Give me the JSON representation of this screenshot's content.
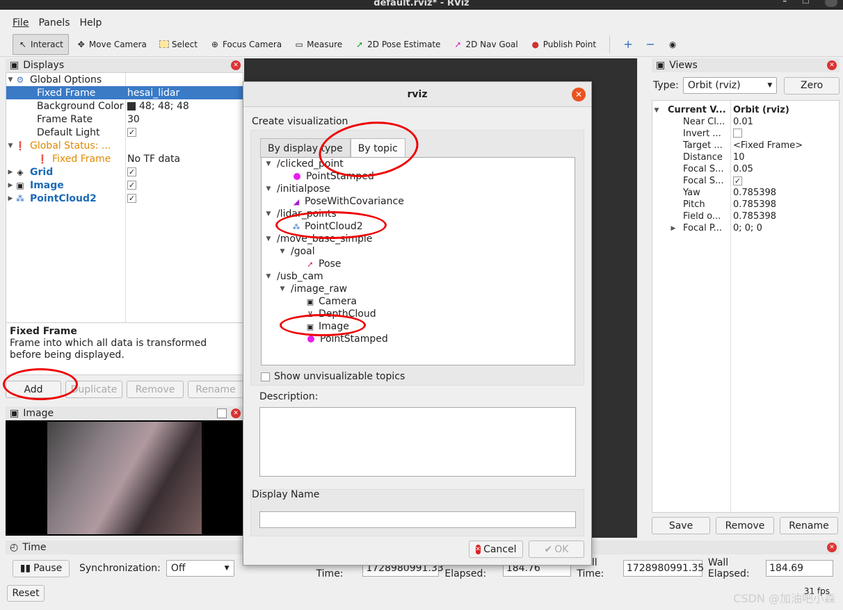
{
  "window": {
    "title": "default.rviz* - RViz",
    "min_label": "–",
    "max_label": "☐"
  },
  "menu": [
    "File",
    "Panels",
    "Help"
  ],
  "toolbar": {
    "tools": [
      {
        "label": "Interact",
        "icon": "cursor-icon"
      },
      {
        "label": "Move Camera",
        "icon": "move-icon"
      },
      {
        "label": "Select",
        "icon": "select-icon"
      },
      {
        "label": "Focus Camera",
        "icon": "focus-icon"
      },
      {
        "label": "Measure",
        "icon": "ruler-icon"
      },
      {
        "label": "2D Pose Estimate",
        "icon": "green-arrow-icon"
      },
      {
        "label": "2D Nav Goal",
        "icon": "pink-arrow-icon"
      },
      {
        "label": "Publish Point",
        "icon": "pin-icon"
      }
    ]
  },
  "displays": {
    "title": "Displays",
    "rows": [
      {
        "label": "Global Options",
        "value": ""
      },
      {
        "label": "Fixed Frame",
        "value": "hesai_lidar"
      },
      {
        "label": "Background Color",
        "value": "48; 48; 48"
      },
      {
        "label": "Frame Rate",
        "value": "30"
      },
      {
        "label": "Default Light",
        "value": "✓"
      },
      {
        "label": "Global Status: ...",
        "value": ""
      },
      {
        "label": "Fixed Frame",
        "value": "No TF data"
      },
      {
        "label": "Grid",
        "value": "✓"
      },
      {
        "label": "Image",
        "value": "✓"
      },
      {
        "label": "PointCloud2",
        "value": "✓"
      }
    ],
    "desc_title": "Fixed Frame",
    "desc_text": "Frame into which all data is transformed before being displayed.",
    "buttons": {
      "add": "Add",
      "duplicate": "Duplicate",
      "remove": "Remove",
      "rename": "Rename"
    }
  },
  "image_panel": {
    "title": "Image"
  },
  "views": {
    "title": "Views",
    "type_label": "Type:",
    "type_value": "Orbit (rviz)",
    "zero": "Zero",
    "rows": [
      {
        "label": "Current V...",
        "value": "Orbit (rviz)"
      },
      {
        "label": "Near Cl...",
        "value": "0.01"
      },
      {
        "label": "Invert ...",
        "value": ""
      },
      {
        "label": "Target ...",
        "value": "<Fixed Frame>"
      },
      {
        "label": "Distance",
        "value": "10"
      },
      {
        "label": "Focal S...",
        "value": "0.05"
      },
      {
        "label": "Focal S...",
        "value": "✓"
      },
      {
        "label": "Yaw",
        "value": "0.785398"
      },
      {
        "label": "Pitch",
        "value": "0.785398"
      },
      {
        "label": "Field o...",
        "value": "0.785398"
      },
      {
        "label": "Focal P...",
        "value": "0; 0; 0"
      }
    ],
    "buttons": {
      "save": "Save",
      "remove": "Remove",
      "rename": "Rename"
    }
  },
  "time": {
    "title": "Time",
    "pause": "Pause",
    "sync_label": "Synchronization:",
    "sync_value": "Off",
    "ros_time_label": "ROS Time:",
    "ros_time": "1728980991.33",
    "ros_elapsed_label": "ROS Elapsed:",
    "ros_elapsed": "184.76",
    "wall_time_label": "Wall Time:",
    "wall_time": "1728980991.35",
    "wall_elapsed_label": "Wall Elapsed:",
    "wall_elapsed": "184.69",
    "reset": "Reset",
    "fps": "31 fps",
    "watermark": "CSDN @加油吧小森"
  },
  "dialog": {
    "title": "rviz",
    "create_label": "Create visualization",
    "tab_type": "By display type",
    "tab_topic": "By topic",
    "topics": [
      {
        "text": "/clicked_point",
        "level": 0,
        "kind": "topic"
      },
      {
        "text": "PointStamped",
        "level": 1,
        "kind": "dot"
      },
      {
        "text": "/initialpose",
        "level": 0,
        "kind": "topic"
      },
      {
        "text": "PoseWithCovariance",
        "level": 1,
        "kind": "pose-cov"
      },
      {
        "text": "/lidar_points",
        "level": 0,
        "kind": "topic"
      },
      {
        "text": "PointCloud2",
        "level": 1,
        "kind": "cloud"
      },
      {
        "text": "/move_base_simple",
        "level": 0,
        "kind": "topic"
      },
      {
        "text": "/goal",
        "level": 1,
        "kind": "topic"
      },
      {
        "text": "Pose",
        "level": 2,
        "kind": "pose"
      },
      {
        "text": "/usb_cam",
        "level": 0,
        "kind": "topic"
      },
      {
        "text": "/image_raw",
        "level": 1,
        "kind": "topic"
      },
      {
        "text": "Camera",
        "level": 2,
        "kind": "camera"
      },
      {
        "text": "DepthCloud",
        "level": 2,
        "kind": "depth"
      },
      {
        "text": "Image",
        "level": 2,
        "kind": "image"
      },
      {
        "text": "PointStamped",
        "level": 2,
        "kind": "dot"
      }
    ],
    "show_unvis": "Show unvisualizable topics",
    "description_label": "Description:",
    "display_name_label": "Display Name",
    "cancel": "Cancel",
    "ok": "OK"
  }
}
